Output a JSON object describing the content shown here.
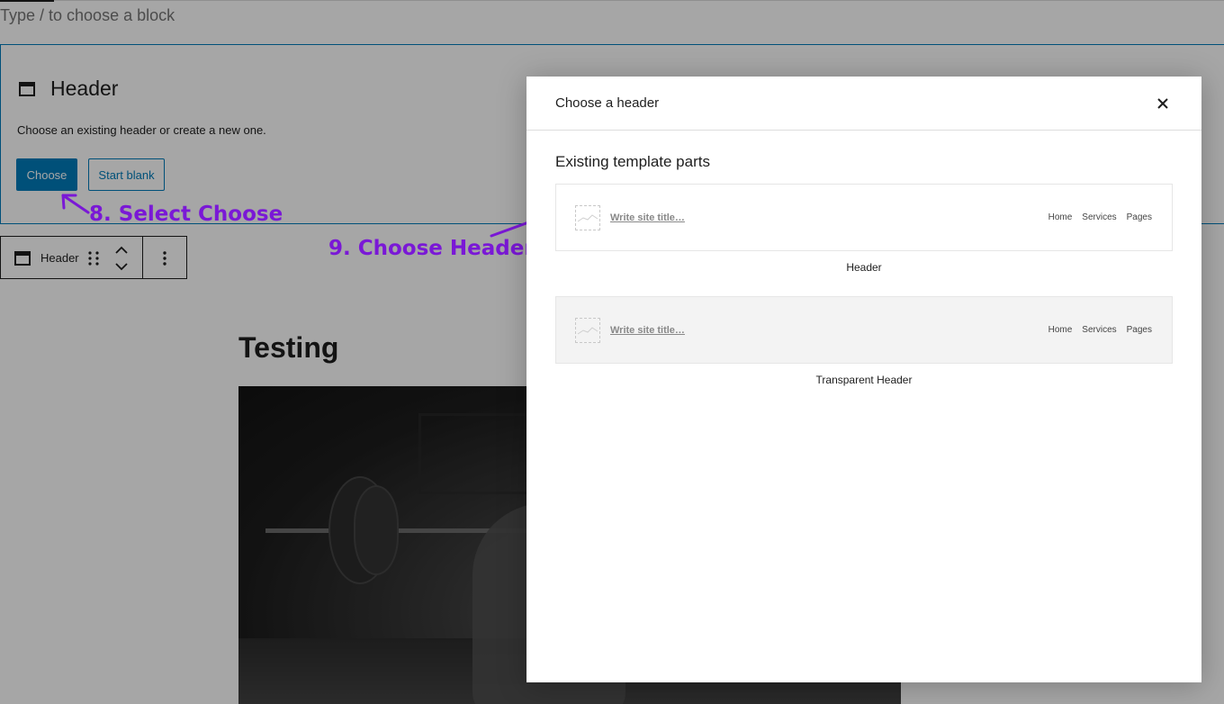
{
  "editor": {
    "block_placeholder": "Type / to choose a block",
    "header_block": {
      "title": "Header",
      "description": "Choose an existing header or create a new one.",
      "choose_label": "Choose",
      "start_blank_label": "Start blank"
    },
    "toolbar": {
      "block_label": "Header"
    },
    "post": {
      "title": "Testing"
    }
  },
  "annotations": {
    "step8": "8. Select Choose",
    "step9": "9. Choose Header",
    "color": "#7a18d6"
  },
  "modal": {
    "title": "Choose a header",
    "section_title": "Existing template parts",
    "parts": [
      {
        "site_title": "Write site title…",
        "nav": [
          "Home",
          "Services",
          "Pages"
        ],
        "caption": "Header"
      },
      {
        "site_title": "Write site title…",
        "nav": [
          "Home",
          "Services",
          "Pages"
        ],
        "caption": "Transparent Header"
      }
    ]
  },
  "colors": {
    "accent": "#007cba",
    "overlay": "rgba(0,0,0,0.35)"
  }
}
